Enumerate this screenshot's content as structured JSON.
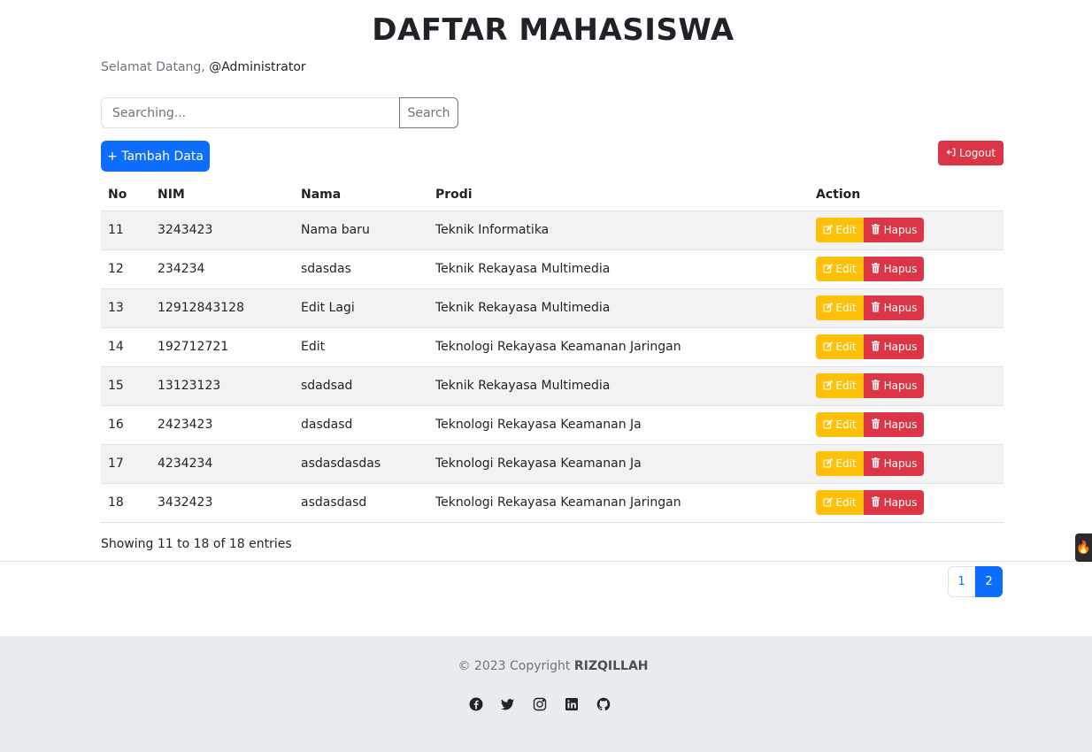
{
  "header": {
    "title": "DAFTAR MAHASISWA",
    "welcome_prefix": "Selamat Datang, ",
    "welcome_user": "@Administrator"
  },
  "search": {
    "placeholder": "Searching...",
    "value": "",
    "button_label": "Search"
  },
  "toolbar": {
    "add_label": "+ Tambah Data",
    "logout_label": "Logout"
  },
  "table": {
    "headers": [
      "No",
      "NIM",
      "Nama",
      "Prodi",
      "Action"
    ],
    "rows": [
      {
        "no": "11",
        "nim": "3243423",
        "nama": "Nama baru",
        "prodi": "Teknik Informatika"
      },
      {
        "no": "12",
        "nim": "234234",
        "nama": "sdasdas",
        "prodi": "Teknik Rekayasa Multimedia"
      },
      {
        "no": "13",
        "nim": "12912843128",
        "nama": "Edit Lagi",
        "prodi": "Teknik Rekayasa Multimedia"
      },
      {
        "no": "14",
        "nim": "192712721",
        "nama": "Edit",
        "prodi": "Teknologi Rekayasa Keamanan Jaringan"
      },
      {
        "no": "15",
        "nim": "13123123",
        "nama": "sdadsad",
        "prodi": "Teknik Rekayasa Multimedia"
      },
      {
        "no": "16",
        "nim": "2423423",
        "nama": "dasdasd",
        "prodi": "Teknologi Rekayasa Keamanan Ja"
      },
      {
        "no": "17",
        "nim": "4234234",
        "nama": "asdasdasdas",
        "prodi": "Teknologi Rekayasa Keamanan Ja"
      },
      {
        "no": "18",
        "nim": "3432423",
        "nama": "asdasdasd",
        "prodi": "Teknologi Rekayasa Keamanan Jaringan"
      }
    ],
    "edit_label": "Edit",
    "hapus_label": "Hapus"
  },
  "entries_info": "Showing 11 to 18 of 18 entries",
  "pagination": {
    "pages": [
      "1",
      "2"
    ],
    "active": "2"
  },
  "footer": {
    "copyright_prefix": "© 2023 Copyright ",
    "copyright_owner": "RIZQILLAH",
    "socials": [
      "facebook-icon",
      "twitter-icon",
      "instagram-icon",
      "linkedin-icon",
      "github-icon"
    ]
  },
  "colors": {
    "primary": "#0d6efd",
    "danger": "#dc3545",
    "warning": "#ffc107",
    "footer_bg": "#e9ecef"
  }
}
